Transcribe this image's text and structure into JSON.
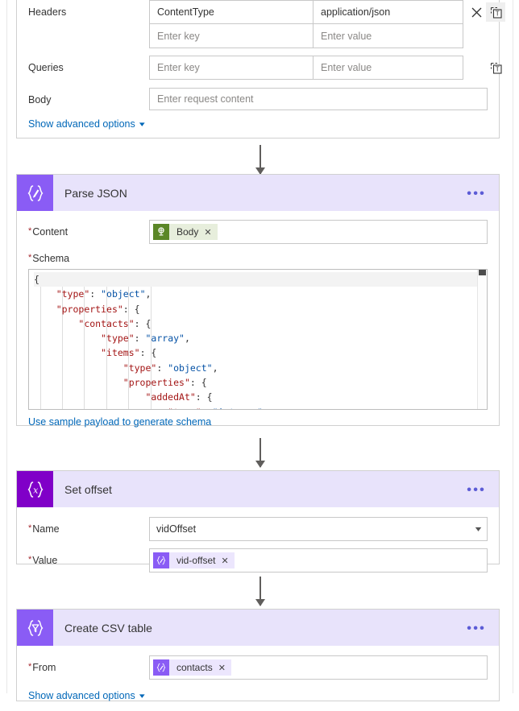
{
  "http_card": {
    "headers": {
      "label": "Headers",
      "rows": [
        {
          "key": "ContentType",
          "value": "application/json",
          "key_placeholder": "",
          "value_placeholder": ""
        },
        {
          "key": "",
          "value": "",
          "key_placeholder": "Enter key",
          "value_placeholder": "Enter value"
        }
      ],
      "delete_icon": "close-icon",
      "dynamic_icon": "text-token-icon"
    },
    "queries": {
      "label": "Queries",
      "rows": [
        {
          "key": "",
          "value": "",
          "key_placeholder": "Enter key",
          "value_placeholder": "Enter value"
        }
      ],
      "dynamic_icon": "text-token-icon"
    },
    "body": {
      "label": "Body",
      "value": "",
      "placeholder": "Enter request content"
    },
    "advanced_link": "Show advanced options"
  },
  "parse_json_card": {
    "title": "Parse JSON",
    "icon": "braces-pen-icon",
    "menu": "•••",
    "content": {
      "label": "Content",
      "required": "*",
      "token": {
        "text": "Body",
        "icon": "http-connector-icon",
        "remove": "✕",
        "color": "#5b8727"
      }
    },
    "schema": {
      "label": "Schema",
      "required": "*",
      "lines": [
        [
          {
            "t": "{",
            "c": "p"
          }
        ],
        [
          {
            "t": "    ",
            "c": "p"
          },
          {
            "t": "\"type\"",
            "c": "k"
          },
          {
            "t": ": ",
            "c": "p"
          },
          {
            "t": "\"object\"",
            "c": "v"
          },
          {
            "t": ",",
            "c": "p"
          }
        ],
        [
          {
            "t": "    ",
            "c": "p"
          },
          {
            "t": "\"properties\"",
            "c": "k"
          },
          {
            "t": ": {",
            "c": "p"
          }
        ],
        [
          {
            "t": "        ",
            "c": "p"
          },
          {
            "t": "\"contacts\"",
            "c": "k"
          },
          {
            "t": ": {",
            "c": "p"
          }
        ],
        [
          {
            "t": "            ",
            "c": "p"
          },
          {
            "t": "\"type\"",
            "c": "k"
          },
          {
            "t": ": ",
            "c": "p"
          },
          {
            "t": "\"array\"",
            "c": "v"
          },
          {
            "t": ",",
            "c": "p"
          }
        ],
        [
          {
            "t": "            ",
            "c": "p"
          },
          {
            "t": "\"items\"",
            "c": "k"
          },
          {
            "t": ": {",
            "c": "p"
          }
        ],
        [
          {
            "t": "                ",
            "c": "p"
          },
          {
            "t": "\"type\"",
            "c": "k"
          },
          {
            "t": ": ",
            "c": "p"
          },
          {
            "t": "\"object\"",
            "c": "v"
          },
          {
            "t": ",",
            "c": "p"
          }
        ],
        [
          {
            "t": "                ",
            "c": "p"
          },
          {
            "t": "\"properties\"",
            "c": "k"
          },
          {
            "t": ": {",
            "c": "p"
          }
        ],
        [
          {
            "t": "                    ",
            "c": "p"
          },
          {
            "t": "\"addedAt\"",
            "c": "k"
          },
          {
            "t": ": {",
            "c": "p"
          }
        ],
        [
          {
            "t": "                        ",
            "c": "p"
          },
          {
            "t": "\"type\"",
            "c": "k"
          },
          {
            "t": ": ",
            "c": "p"
          },
          {
            "t": "\"integer\"",
            "c": "v"
          }
        ]
      ]
    },
    "sample_payload_link": "Use sample payload to generate schema"
  },
  "set_offset_card": {
    "title": "Set offset",
    "icon": "braces-x-icon",
    "menu": "•••",
    "name": {
      "label": "Name",
      "required": "*",
      "value": "vidOffset",
      "chevron": "chevron-down-icon"
    },
    "value": {
      "label": "Value",
      "required": "*",
      "token": {
        "text": "vid-offset",
        "icon": "expression-icon",
        "remove": "✕",
        "color": "#8a5cf5"
      }
    }
  },
  "create_csv_card": {
    "title": "Create CSV table",
    "icon": "braces-funnel-icon",
    "menu": "•••",
    "from": {
      "label": "From",
      "required": "*",
      "token": {
        "text": "contacts",
        "icon": "expression-icon",
        "remove": "✕",
        "color": "#8a5cf5"
      }
    },
    "advanced_link": "Show advanced options"
  },
  "theme": {
    "accent_purple": "#8a5cf5",
    "dark_purple": "#8000c8",
    "header_bg": "#e8e3fb",
    "link_blue": "#0067b8",
    "required_red": "#a4262c",
    "json_key": "#a31515",
    "json_value": "#0451a5"
  }
}
